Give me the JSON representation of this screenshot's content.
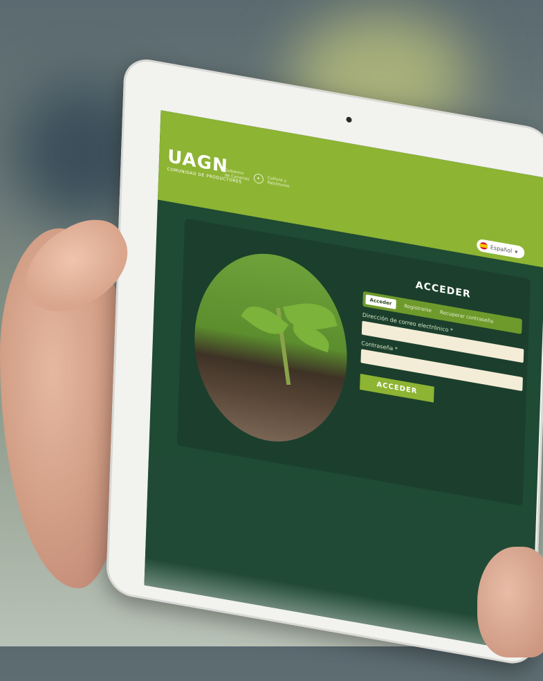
{
  "brand": {
    "logo": "UAGN",
    "logo_sub": "COMUNIDAD DE PRODUCTORES",
    "gov_line1": "Gobierno",
    "gov_line2": "de Canarias",
    "gov_line3": "Cultura y",
    "gov_line4": "Patrimonio"
  },
  "header": {
    "language": "Español",
    "language_flag": "spain-flag-icon"
  },
  "login": {
    "title": "ACCEDER",
    "tabs": [
      {
        "label": "Acceder",
        "active": true
      },
      {
        "label": "Registrarse",
        "active": false
      },
      {
        "label": "Recuperar contraseña",
        "active": false
      }
    ],
    "email_label": "Dirección de correo electrónico *",
    "email_value": "",
    "password_label": "Contraseña *",
    "password_value": "",
    "submit_label": "ACCEDER"
  },
  "colors": {
    "brand_green": "#8db433",
    "panel_dark": "#1b3f2c",
    "screen_bg": "#1f4a33",
    "input_bg": "#f3ecd6"
  }
}
